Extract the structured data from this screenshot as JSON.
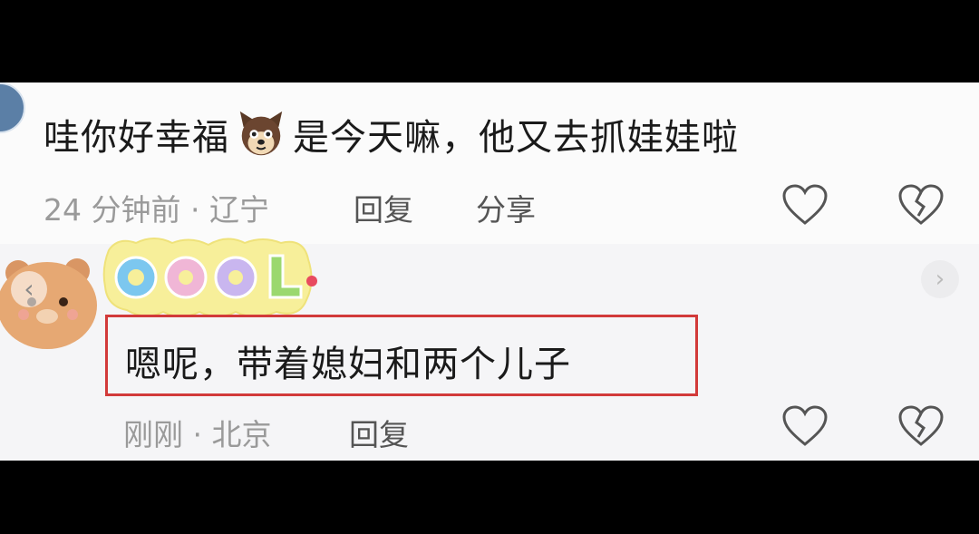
{
  "comment1": {
    "text_before": "哇你好幸福",
    "text_after": "是今天嘛，他又去抓娃娃啦",
    "time": "24 分钟前",
    "location": "辽宁",
    "reply_label": "回复",
    "share_label": "分享"
  },
  "reply1": {
    "text": "嗯呢，带着媳妇和两个儿子",
    "time": "刚刚",
    "location": "北京",
    "reply_label": "回复",
    "sticker_text": "COOL"
  },
  "colors": {
    "highlight_box": "#d23a3a",
    "meta_gray": "#9a9a9a"
  },
  "icons": [
    "dog-emoji-icon",
    "heart-icon",
    "broken-heart-icon",
    "chevron-left-icon",
    "chevron-right-icon"
  ]
}
